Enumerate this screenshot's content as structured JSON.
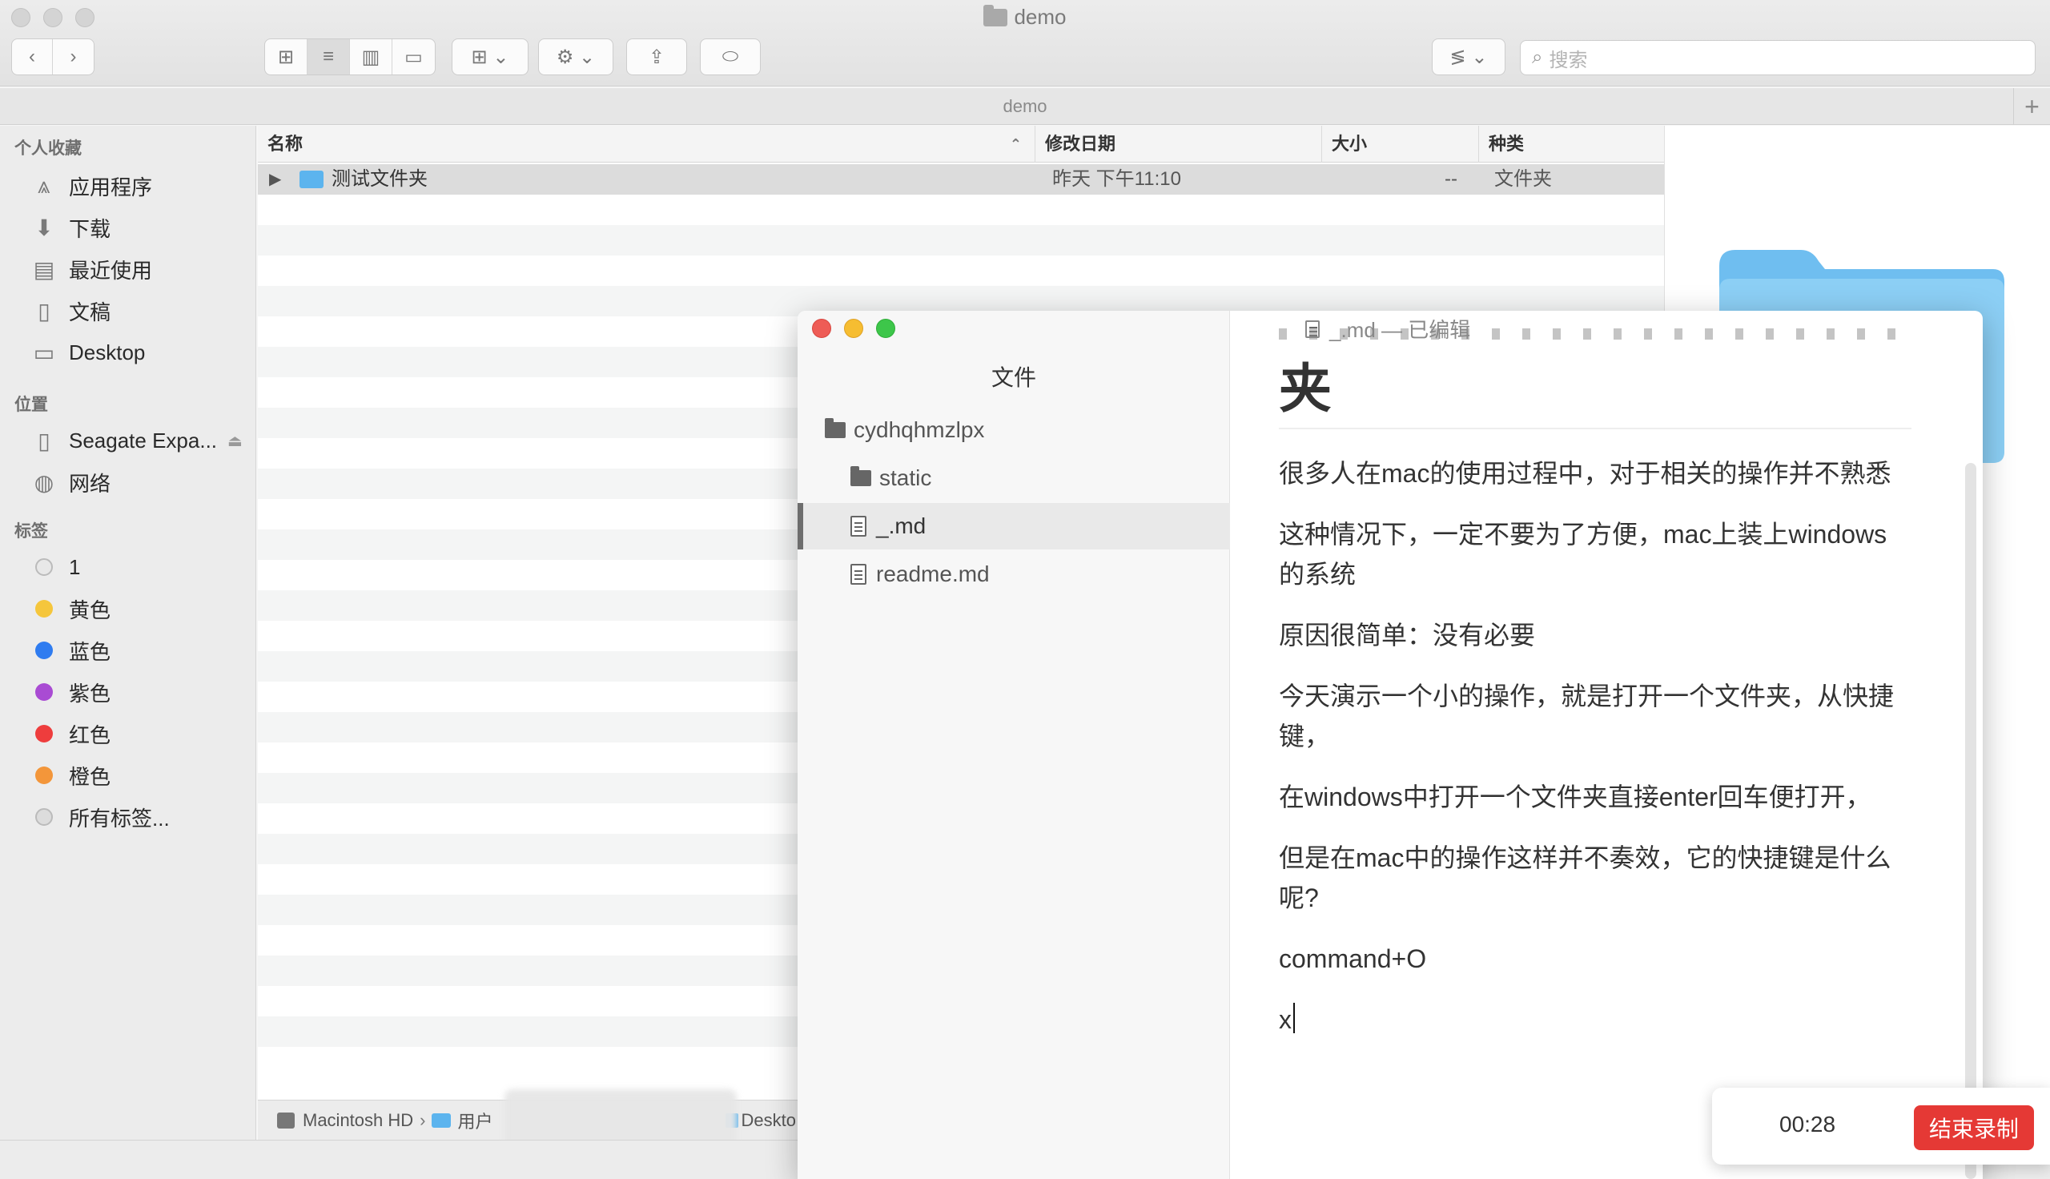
{
  "finder": {
    "window_title": "demo",
    "path_title": "demo",
    "search_placeholder": "搜索",
    "sidebar": {
      "favorites_header": "个人收藏",
      "favorites": [
        {
          "label": "应用程序",
          "icon": "applications-icon"
        },
        {
          "label": "下载",
          "icon": "downloads-icon"
        },
        {
          "label": "最近使用",
          "icon": "recents-icon"
        },
        {
          "label": "文稿",
          "icon": "documents-icon"
        },
        {
          "label": "Desktop",
          "icon": "desktop-icon"
        }
      ],
      "locations_header": "位置",
      "locations": [
        {
          "label": "Seagate Expa...",
          "icon": "external-drive-icon"
        },
        {
          "label": "网络",
          "icon": "network-icon"
        }
      ],
      "tags_header": "标签",
      "tags": [
        {
          "label": "1",
          "color": "#e8e8e8"
        },
        {
          "label": "黄色",
          "color": "#f5c63c"
        },
        {
          "label": "蓝色",
          "color": "#2f7cf0"
        },
        {
          "label": "紫色",
          "color": "#a94bd3"
        },
        {
          "label": "红色",
          "color": "#ee3d3d"
        },
        {
          "label": "橙色",
          "color": "#f3963a"
        },
        {
          "label": "所有标签...",
          "color": "#dcdcdc"
        }
      ]
    },
    "columns": {
      "name": "名称",
      "date": "修改日期",
      "size": "大小",
      "kind": "种类"
    },
    "rows": [
      {
        "name": "测试文件夹",
        "date": "昨天 下午11:10",
        "size": "--",
        "kind": "文件夹"
      }
    ],
    "statusbar": {
      "disk": "Macintosh HD",
      "users": "用户",
      "desktop": "Deskto"
    }
  },
  "typora": {
    "doc_title": "_.md — 已编辑",
    "files_title": "文件",
    "tree": [
      {
        "label": "cydhqhmzlpx",
        "type": "folder"
      },
      {
        "label": "static",
        "type": "folder"
      },
      {
        "label": "_.md",
        "type": "file",
        "selected": true
      },
      {
        "label": "readme.md",
        "type": "file"
      }
    ],
    "heading_tail": "夹",
    "paragraphs": [
      "很多人在mac的使用过程中，对于相关的操作并不熟悉",
      "这种情况下，一定不要为了方便，mac上装上windows的系统",
      "原因很简单：没有必要",
      "今天演示一个小的操作，就是打开一个文件夹，从快捷键，",
      "在windows中打开一个文件夹直接enter回车便打开，",
      "但是在mac中的操作这样并不奏效，它的快捷键是什么呢?",
      "command+O",
      "x"
    ]
  },
  "recorder": {
    "time": "00:28",
    "stop_label": "结束录制"
  },
  "colors": {
    "accent_red": "#e53935",
    "folder_blue": "#5cb4ee"
  }
}
